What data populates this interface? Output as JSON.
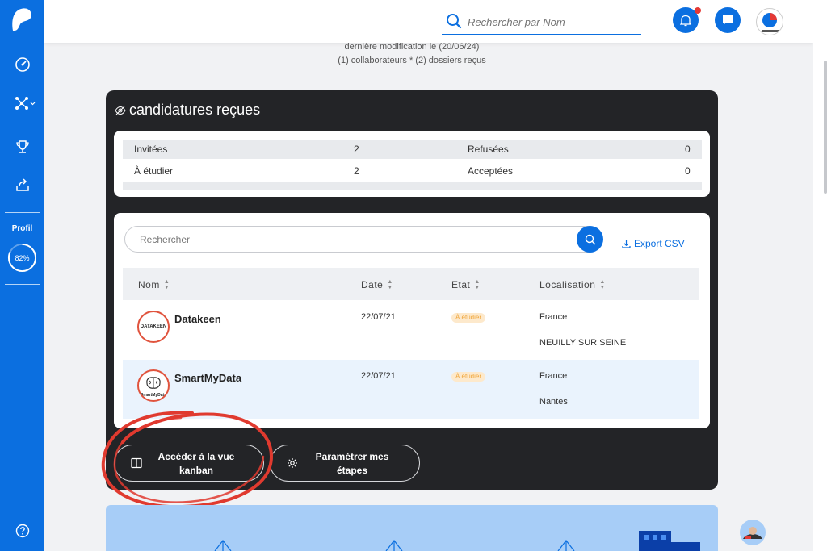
{
  "sidebar": {
    "logo": "brand-logo",
    "items": [
      {
        "icon": "dashboard-icon"
      },
      {
        "icon": "network-icon"
      },
      {
        "icon": "trophy-icon"
      },
      {
        "icon": "share-icon"
      }
    ],
    "profile_label": "Profil",
    "profile_percent": "82%",
    "profile_progress": 0.82,
    "help_icon": "help-icon"
  },
  "topbar": {
    "search_placeholder": "Rechercher par Nom",
    "notifications_icon": "bell-icon",
    "messages_icon": "chat-icon",
    "avatar_icon": "user-avatar"
  },
  "meta": {
    "modified": "dernière modification le (20/06/24)",
    "counts": "(1) collaborateurs * (2) dossiers reçus"
  },
  "card": {
    "title": "candidatures reçues",
    "stats": [
      {
        "label": "Invitées",
        "value": "2",
        "label2": "Refusées",
        "value2": "0"
      },
      {
        "label": "À étudier",
        "value": "2",
        "label2": "Acceptées",
        "value2": "0"
      }
    ],
    "search_placeholder": "Rechercher",
    "export_label": "Export CSV",
    "columns": [
      "Nom",
      "Date",
      "Etat",
      "Localisation"
    ],
    "rows": [
      {
        "logo_text": "DATAKEEN",
        "name": "Datakeen",
        "date": "22/07/21",
        "status": "À étudier",
        "country": "France",
        "city": "NEUILLY SUR SEINE"
      },
      {
        "logo_text": "SmartMyData",
        "name": "SmartMyData",
        "date": "22/07/21",
        "status": "À étudier",
        "country": "France",
        "city": "Nantes"
      }
    ],
    "buttons": {
      "kanban_line1": "Accéder à la vue",
      "kanban_line2": "kanban",
      "steps_line1": "Paramétrer mes",
      "steps_line2": "étapes"
    }
  },
  "colors": {
    "primary": "#0b6fe0",
    "dark_card": "#232427",
    "badge_text": "#f0a53a",
    "annotation_red": "#e03a2f"
  }
}
